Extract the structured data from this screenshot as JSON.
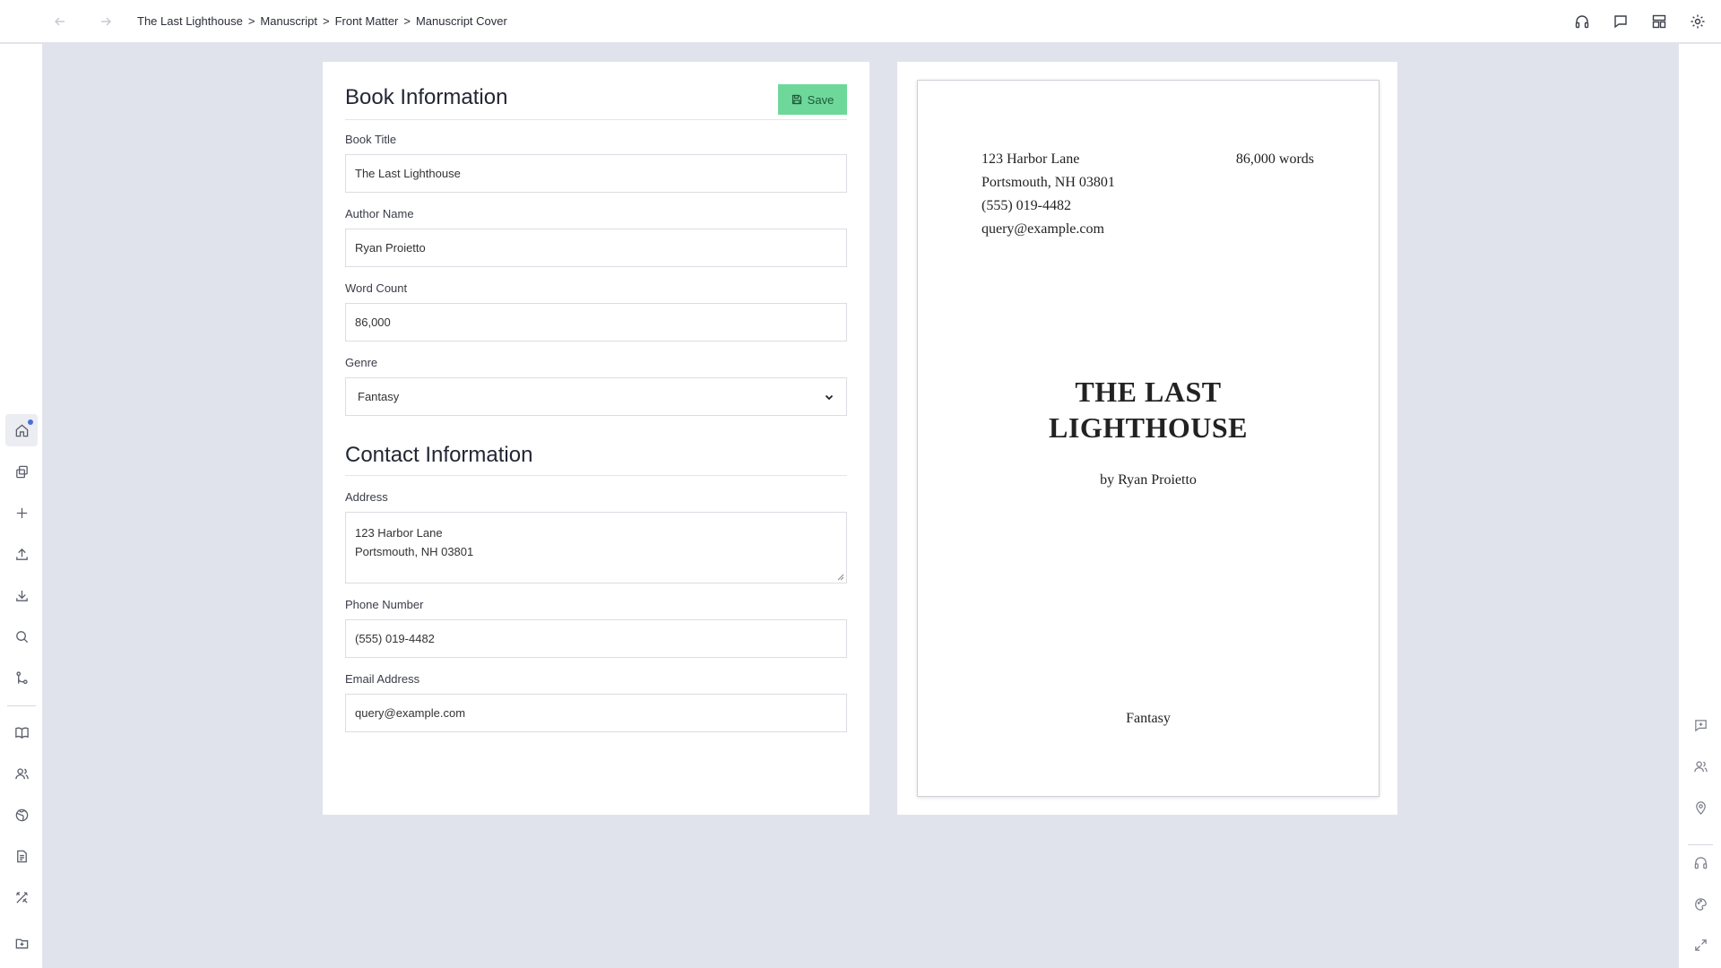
{
  "breadcrumb": [
    "The Last Lighthouse",
    "Manuscript",
    "Front Matter",
    "Manuscript Cover"
  ],
  "breadcrumb_separator": ">",
  "form": {
    "book_info_title": "Book Information",
    "save_label": "Save",
    "book_title_label": "Book Title",
    "book_title_value": "The Last Lighthouse",
    "author_label": "Author Name",
    "author_value": "Ryan Proietto",
    "word_count_label": "Word Count",
    "word_count_value": "86,000",
    "genre_label": "Genre",
    "genre_value": "Fantasy",
    "contact_title": "Contact Information",
    "address_label": "Address",
    "address_line1": "123 Harbor Lane",
    "address_line2": "Portsmouth, NH 03801",
    "phone_label": "Phone Number",
    "phone_value": "(555) 019-4482",
    "email_label": "Email Address",
    "email_value": "query@example.com"
  },
  "preview": {
    "address_line1": "123 Harbor Lane",
    "address_line2": "Portsmouth, NH 03801",
    "phone": "(555) 019-4482",
    "email": "query@example.com",
    "word_count": "86,000 words",
    "title_line1": "THE LAST",
    "title_line2": "LIGHTHOUSE",
    "byline": "by Ryan Proietto",
    "genre": "Fantasy"
  },
  "colors": {
    "save_button": "#6ed89a",
    "background": "#e1e3ec",
    "notification_dot": "#4a6fd8"
  },
  "icons": {
    "top": [
      "headphones-icon",
      "comment-icon",
      "layout-icon",
      "gear-icon"
    ],
    "left": [
      "home-icon",
      "copy-icon",
      "plus-icon",
      "upload-icon",
      "download-icon",
      "search-icon",
      "git-branch-icon",
      "book-icon",
      "users-icon",
      "globe-icon",
      "document-icon",
      "tools-icon",
      "folder-icon"
    ],
    "right": [
      "add-comment-icon",
      "users-icon",
      "location-icon",
      "headphones-icon",
      "palette-icon",
      "expand-icon"
    ]
  }
}
